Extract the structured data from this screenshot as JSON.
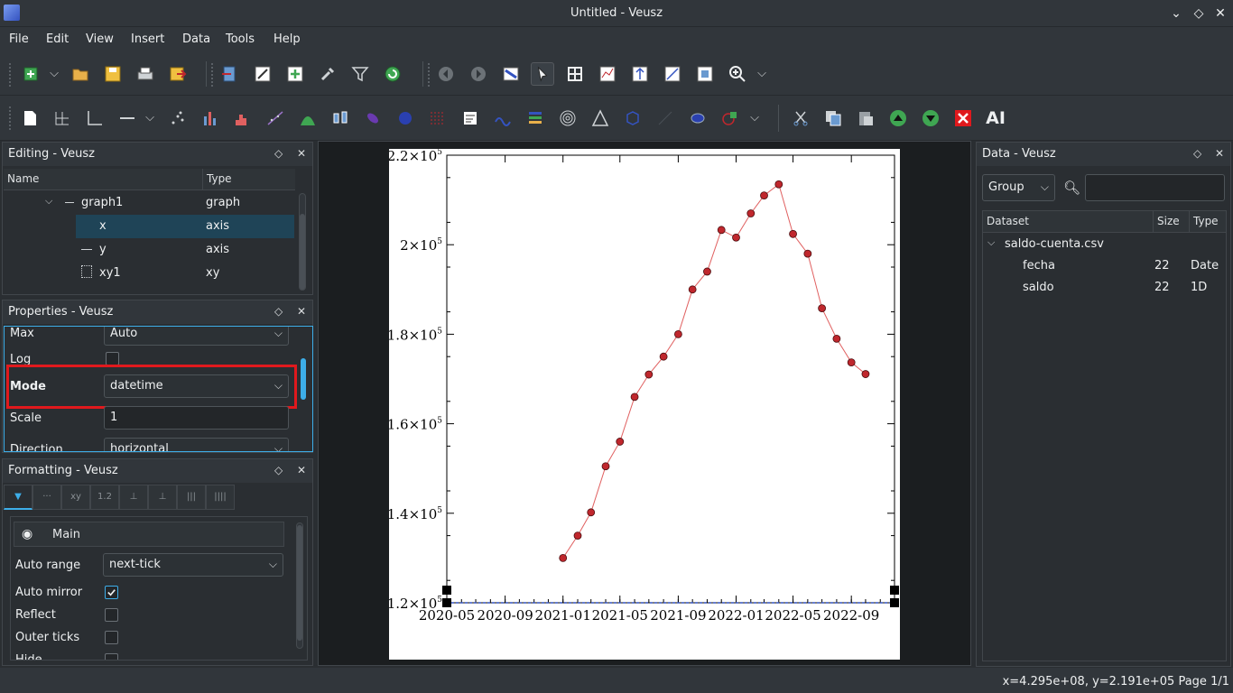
{
  "window": {
    "title": "Untitled - Veusz",
    "minimize": "⌄",
    "maximize": "◇",
    "close": "✕"
  },
  "menu": [
    "File",
    "Edit",
    "View",
    "Insert",
    "Data",
    "Tools",
    "Help"
  ],
  "editing_panel": {
    "title": "Editing - Veusz",
    "col_name": "Name",
    "col_type": "Type",
    "rows": [
      {
        "name": "graph1",
        "type": "graph"
      },
      {
        "name": "x",
        "type": "axis"
      },
      {
        "name": "y",
        "type": "axis"
      },
      {
        "name": "xy1",
        "type": "xy"
      }
    ]
  },
  "properties_panel": {
    "title": "Properties - Veusz",
    "max_label": "Max",
    "max_value": "Auto",
    "log_label": "Log",
    "mode_label": "Mode",
    "mode_value": "datetime",
    "scale_label": "Scale",
    "scale_value": "1",
    "direction_label": "Direction",
    "direction_value": "horizontal"
  },
  "formatting_panel": {
    "title": "Formatting - Veusz",
    "tabs": [
      "▼",
      "···",
      "xy",
      "1.2",
      "⊥",
      "⊥",
      "|||",
      "||||"
    ],
    "section": "Main",
    "auto_range_label": "Auto range",
    "auto_range_value": "next-tick",
    "auto_mirror_label": "Auto mirror",
    "auto_mirror_checked": true,
    "reflect_label": "Reflect",
    "outer_ticks_label": "Outer ticks",
    "hide_label": "Hide"
  },
  "data_panel": {
    "title": "Data - Veusz",
    "group_value": "Group",
    "search_placeholder": "",
    "col_dataset": "Dataset",
    "col_size": "Size",
    "col_type": "Type",
    "file": "saldo-cuenta.csv",
    "datasets": [
      {
        "name": "fecha",
        "size": "22",
        "type": "Date"
      },
      {
        "name": "saldo",
        "size": "22",
        "type": "1D"
      }
    ]
  },
  "status": {
    "text": "x=4.295e+08, y=2.191e+05  Page 1/1"
  },
  "colors": {
    "accent": "#3daee9",
    "marker": "#c0272d",
    "line": "#e06060",
    "highlight": "#e0191d"
  },
  "chart_data": {
    "type": "line",
    "x_ticks": [
      "2020-05",
      "2020-09",
      "2021-01",
      "2021-05",
      "2021-09",
      "2022-01",
      "2022-05",
      "2022-09"
    ],
    "y_ticks": [
      {
        "value": 120000,
        "label": "1.2×10"
      },
      {
        "value": 140000,
        "label": "1.4×10"
      },
      {
        "value": 160000,
        "label": "1.6×10"
      },
      {
        "value": 180000,
        "label": "1.8×10"
      },
      {
        "value": 200000,
        "label": "2×10"
      },
      {
        "value": 220000,
        "label": "2.2×10"
      }
    ],
    "y_exponent": "5",
    "xlim": [
      "2020-05",
      "2022-12"
    ],
    "ylim": [
      120000,
      220000
    ],
    "x": [
      "2021-01",
      "2021-02",
      "2021-03",
      "2021-04",
      "2021-05",
      "2021-06",
      "2021-07",
      "2021-08",
      "2021-09",
      "2021-10",
      "2021-11",
      "2021-12",
      "2022-01",
      "2022-02",
      "2022-03",
      "2022-04",
      "2022-05",
      "2022-06",
      "2022-07",
      "2022-08",
      "2022-09",
      "2022-10"
    ],
    "y": [
      130000,
      135000,
      140200,
      150500,
      156000,
      166000,
      171000,
      175000,
      180000,
      190000,
      194000,
      203300,
      201600,
      207000,
      211000,
      213500,
      202400,
      198000,
      185800,
      179000,
      173700,
      171100
    ]
  }
}
